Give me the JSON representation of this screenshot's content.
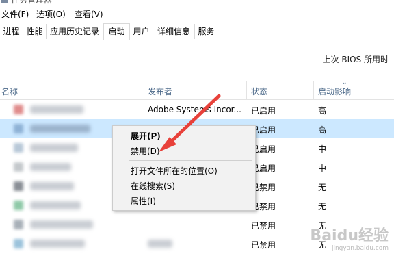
{
  "window": {
    "title": "任务管理器"
  },
  "menubar": {
    "items": [
      "文件(F)",
      "选项(O)",
      "查看(V)"
    ]
  },
  "tabs": [
    "进程",
    "性能",
    "应用历史记录",
    "启动",
    "用户",
    "详细信息",
    "服务"
  ],
  "active_tab": "启动",
  "bios_label": "上次 BIOS 所用时",
  "table": {
    "headers": {
      "name": "名称",
      "publisher": "发布者",
      "status": "状态",
      "impact": "启动影响"
    },
    "rows": [
      {
        "publisher": "Adobe Systems Incor...",
        "status": "已启用",
        "impact": "高"
      },
      {
        "publisher": "",
        "status": "已启用",
        "impact": "高"
      },
      {
        "publisher": "",
        "status": "已启用",
        "impact": "中"
      },
      {
        "publisher": "",
        "status": "已启用",
        "impact": "中"
      },
      {
        "publisher": "",
        "status": "已禁用",
        "impact": "无"
      },
      {
        "publisher": "",
        "status": "已禁用",
        "impact": "无"
      },
      {
        "publisher": "",
        "status": "已禁用",
        "impact": "无"
      },
      {
        "publisher": "",
        "status": "已禁用",
        "impact": "无"
      }
    ]
  },
  "context_menu": {
    "expand": "展开(P)",
    "disable": "禁用(D)",
    "open_location": "打开文件所在的位置(O)",
    "search_online": "在线搜索(S)",
    "properties": "属性(I)"
  },
  "watermark": {
    "main": "Baidu经验",
    "sub": "jingyan.baidu.com"
  },
  "colors": {
    "selected_row": "#cce8ff",
    "arrow": "#e8413a",
    "header_text": "#4d6a8a"
  }
}
